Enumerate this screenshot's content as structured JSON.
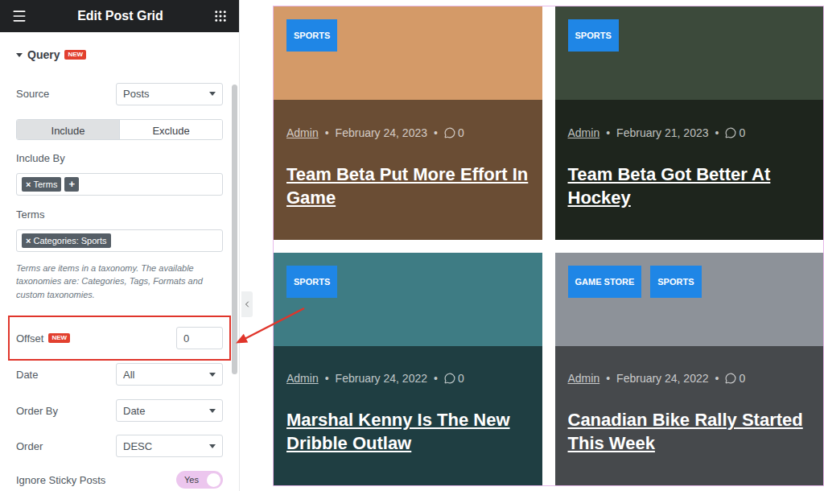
{
  "panel": {
    "title": "Edit Post Grid",
    "section": {
      "title": "Query",
      "badge": "NEW",
      "expanded": true
    },
    "controls": [
      {
        "kind": "select",
        "label": "Source",
        "value": "Posts"
      },
      {
        "kind": "segmented",
        "options": [
          {
            "label": "Include",
            "selected": true
          },
          {
            "label": "Exclude",
            "selected": false
          }
        ]
      },
      {
        "kind": "chips",
        "label": "Include By",
        "chips": [
          {
            "remove": "×",
            "label": "Terms"
          }
        ],
        "add": "+"
      },
      {
        "kind": "chips",
        "label": "Terms",
        "chips": [
          {
            "remove": "×",
            "label": "Categories: Sports"
          }
        ],
        "help": "Terms are items in a taxonomy. The available taxonomies are: Categories, Tags, Formats and custom taxonomies."
      },
      {
        "kind": "number",
        "label": "Offset",
        "badge": "NEW",
        "value": "0",
        "highlighted": true
      },
      {
        "kind": "select",
        "label": "Date",
        "value": "All"
      },
      {
        "kind": "select",
        "label": "Order By",
        "value": "Date"
      },
      {
        "kind": "select",
        "label": "Order",
        "value": "DESC"
      },
      {
        "kind": "switch",
        "label": "Ignore Sticky Posts",
        "on": true,
        "value": "Yes"
      }
    ]
  },
  "grid": {
    "separator": "•",
    "cards": [
      {
        "categories": [
          {
            "label": "SPORTS"
          }
        ],
        "author": "Admin",
        "date": "February 24, 2023",
        "comments": "0",
        "title": "Team Beta Put More Effort In Game",
        "color": "#d49a68"
      },
      {
        "categories": [
          {
            "label": "SPORTS"
          }
        ],
        "author": "Admin",
        "date": "February 21, 2023",
        "comments": "0",
        "title": "Team Beta Got Better At Hockey",
        "color": "#3c4a3b"
      },
      {
        "categories": [
          {
            "label": "SPORTS"
          }
        ],
        "author": "Admin",
        "date": "February 24, 2022",
        "comments": "0",
        "title": "Marshal Kenny Is The New Dribble Outlaw",
        "color": "#3e7c84"
      },
      {
        "categories": [
          {
            "label": "GAME STORE"
          },
          {
            "label": "SPORTS"
          }
        ],
        "author": "Admin",
        "date": "February 24, 2022",
        "comments": "0",
        "title": "Canadian Bike Rally Started This Week",
        "color": "#8d9299"
      }
    ]
  }
}
